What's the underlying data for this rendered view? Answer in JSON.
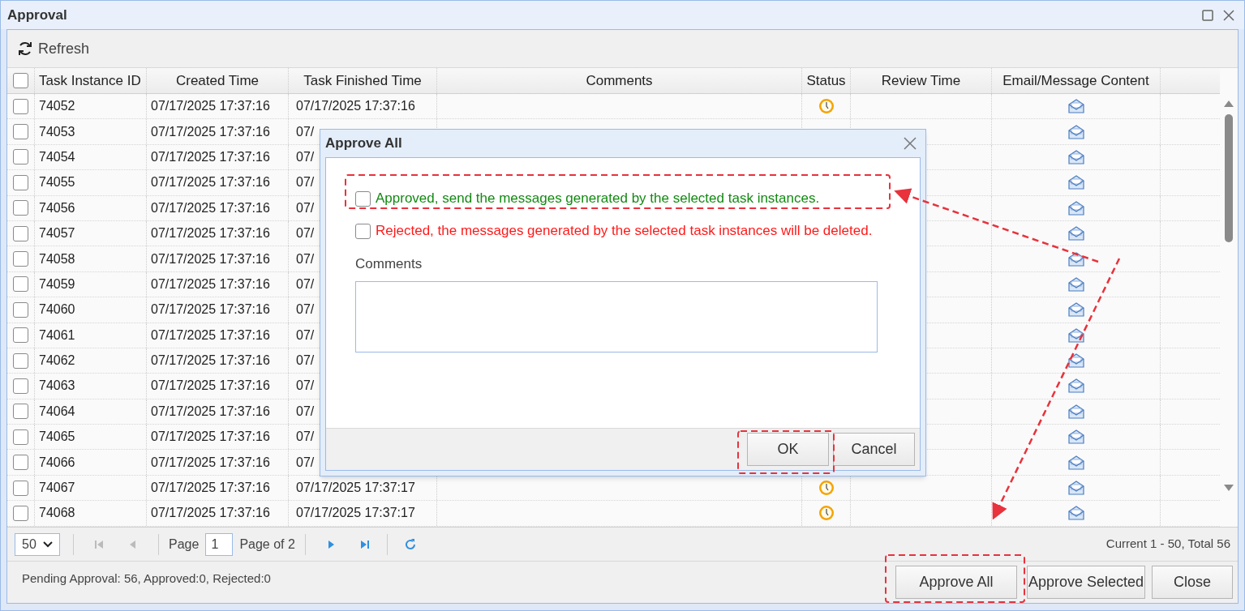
{
  "window": {
    "title": "Approval"
  },
  "toolbar": {
    "refresh": "Refresh"
  },
  "table": {
    "select_all_checked": false,
    "columns": [
      "Task Instance ID",
      "Created Time",
      "Task Finished Time",
      "Comments",
      "Status",
      "Review Time",
      "Email/Message Content"
    ],
    "rows": [
      {
        "checked": false,
        "id": "74052",
        "created": "07/17/2025 17:37:16",
        "finished": "07/17/2025 17:37:16",
        "pending": true
      },
      {
        "checked": false,
        "id": "74053",
        "created": "07/17/2025 17:37:16",
        "finished": "07/"
      },
      {
        "checked": false,
        "id": "74054",
        "created": "07/17/2025 17:37:16",
        "finished": "07/"
      },
      {
        "checked": false,
        "id": "74055",
        "created": "07/17/2025 17:37:16",
        "finished": "07/"
      },
      {
        "checked": false,
        "id": "74056",
        "created": "07/17/2025 17:37:16",
        "finished": "07/"
      },
      {
        "checked": false,
        "id": "74057",
        "created": "07/17/2025 17:37:16",
        "finished": "07/"
      },
      {
        "checked": false,
        "id": "74058",
        "created": "07/17/2025 17:37:16",
        "finished": "07/"
      },
      {
        "checked": false,
        "id": "74059",
        "created": "07/17/2025 17:37:16",
        "finished": "07/"
      },
      {
        "checked": false,
        "id": "74060",
        "created": "07/17/2025 17:37:16",
        "finished": "07/"
      },
      {
        "checked": false,
        "id": "74061",
        "created": "07/17/2025 17:37:16",
        "finished": "07/"
      },
      {
        "checked": false,
        "id": "74062",
        "created": "07/17/2025 17:37:16",
        "finished": "07/"
      },
      {
        "checked": false,
        "id": "74063",
        "created": "07/17/2025 17:37:16",
        "finished": "07/"
      },
      {
        "checked": false,
        "id": "74064",
        "created": "07/17/2025 17:37:16",
        "finished": "07/"
      },
      {
        "checked": false,
        "id": "74065",
        "created": "07/17/2025 17:37:16",
        "finished": "07/"
      },
      {
        "checked": false,
        "id": "74066",
        "created": "07/17/2025 17:37:16",
        "finished": "07/"
      },
      {
        "checked": false,
        "id": "74067",
        "created": "07/17/2025 17:37:16",
        "finished": "07/17/2025 17:37:17",
        "pending": true
      },
      {
        "checked": false,
        "id": "74068",
        "created": "07/17/2025 17:37:16",
        "finished": "07/17/2025 17:37:17",
        "pending": true
      }
    ]
  },
  "pager": {
    "page_size": "50",
    "page_label": "Page",
    "page": "1",
    "page_of": "Page of 2",
    "summary": "Current 1 - 50, Total 56"
  },
  "status_text": "Pending Approval: 56, Approved:0, Rejected:0",
  "buttons": [
    "Approve All",
    "Approve Selected",
    "Close"
  ],
  "dialog": {
    "title": "Approve All",
    "options": [
      {
        "label": "Approved, send the messages generated by the selected task instances.",
        "checked": false,
        "color": "#138a13"
      },
      {
        "label": "Rejected, the messages generated by the selected task instances will be deleted.",
        "checked": false,
        "color": "#ff1a1a"
      }
    ],
    "comments_label": "Comments",
    "buttons": [
      "OK",
      "Cancel"
    ]
  }
}
